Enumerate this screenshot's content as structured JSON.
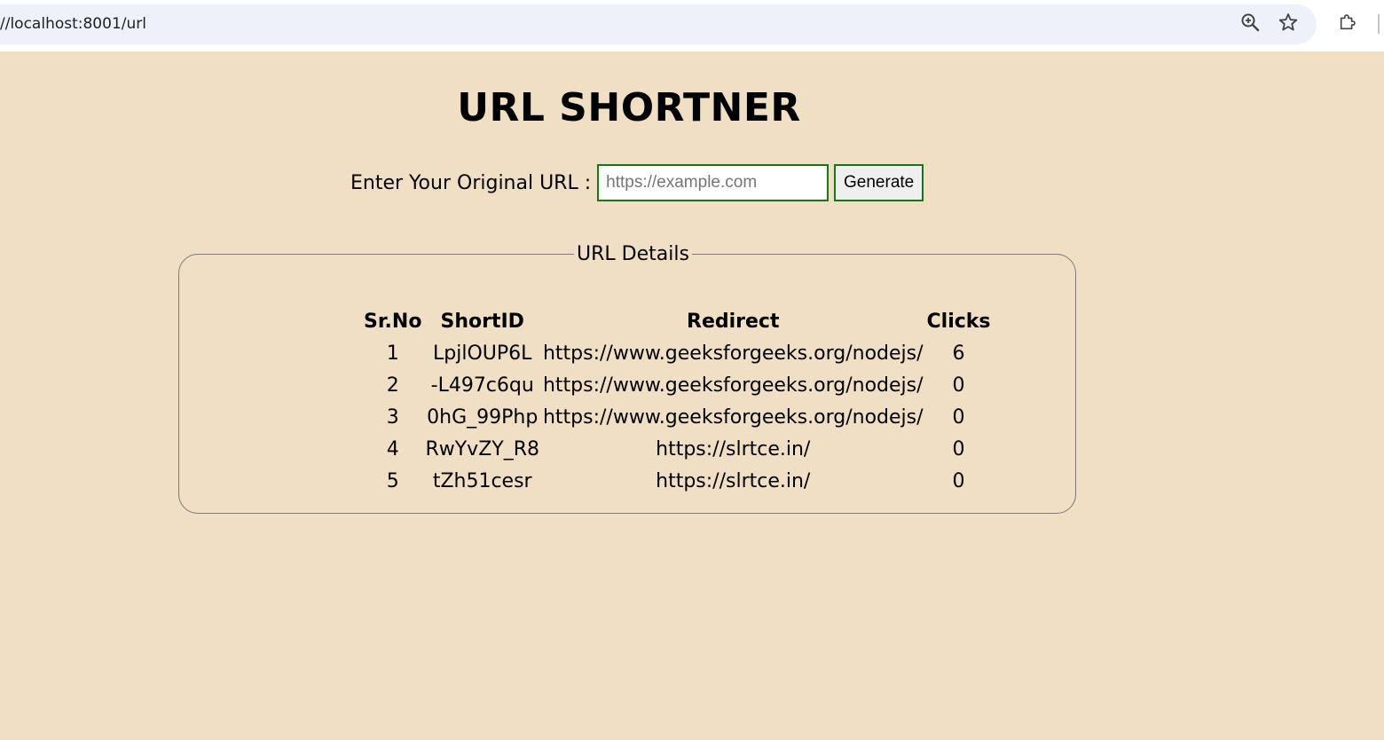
{
  "browser": {
    "url": "//localhost:8001/url"
  },
  "page": {
    "title": "URL SHORTNER",
    "form": {
      "label": "Enter Your Original URL :",
      "input_value": "",
      "input_placeholder": "https://example.com",
      "generate_label": "Generate"
    },
    "details": {
      "legend": "URL Details",
      "columns": [
        "Sr.No",
        "ShortID",
        "Redirect",
        "Clicks"
      ],
      "rows": [
        {
          "sr": "1",
          "short_id": "LpjlOUP6L",
          "redirect": "https://www.geeksforgeeks.org/nodejs/",
          "clicks": "6"
        },
        {
          "sr": "2",
          "short_id": "-L497c6qu",
          "redirect": "https://www.geeksforgeeks.org/nodejs/",
          "clicks": "0"
        },
        {
          "sr": "3",
          "short_id": "0hG_99Php",
          "redirect": "https://www.geeksforgeeks.org/nodejs/",
          "clicks": "0"
        },
        {
          "sr": "4",
          "short_id": "RwYvZY_R8",
          "redirect": "https://slrtce.in/",
          "clicks": "0"
        },
        {
          "sr": "5",
          "short_id": "tZh51cesr",
          "redirect": "https://slrtce.in/",
          "clicks": "0"
        }
      ]
    }
  },
  "colors": {
    "page_background": "#f0dfc5",
    "input_border": "#137a13",
    "omnibox_background": "#edf2fa"
  },
  "icons": [
    "zoom-icon",
    "bookmark-star-icon",
    "extensions-icon"
  ]
}
